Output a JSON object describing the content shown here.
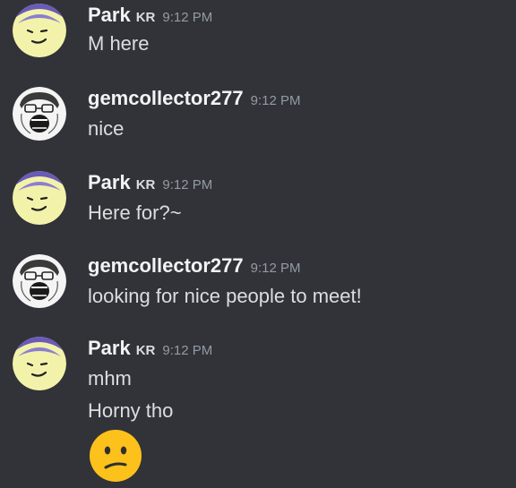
{
  "users": {
    "park": {
      "name": "Park",
      "tag": "KR"
    },
    "gem": {
      "name": "gemcollector277"
    }
  },
  "messages": [
    {
      "author": "Park",
      "tag": "KR",
      "time": "9:12 PM",
      "lines": [
        "M here"
      ]
    },
    {
      "author": "gemcollector277",
      "time": "9:12 PM",
      "lines": [
        "nice"
      ]
    },
    {
      "author": "Park",
      "tag": "KR",
      "time": "9:12 PM",
      "lines": [
        "Here for?~"
      ]
    },
    {
      "author": "gemcollector277",
      "time": "9:12 PM",
      "lines": [
        "looking for nice people to meet!"
      ]
    },
    {
      "author": "Park",
      "tag": "KR",
      "time": "9:12 PM",
      "lines": [
        "mhm",
        "Horny tho"
      ],
      "emoji": "confused-face-emoji"
    }
  ],
  "colors": {
    "background": "#313338",
    "username": "#f2f3f5",
    "text": "#dbdee1",
    "timestamp": "#949ba4"
  }
}
